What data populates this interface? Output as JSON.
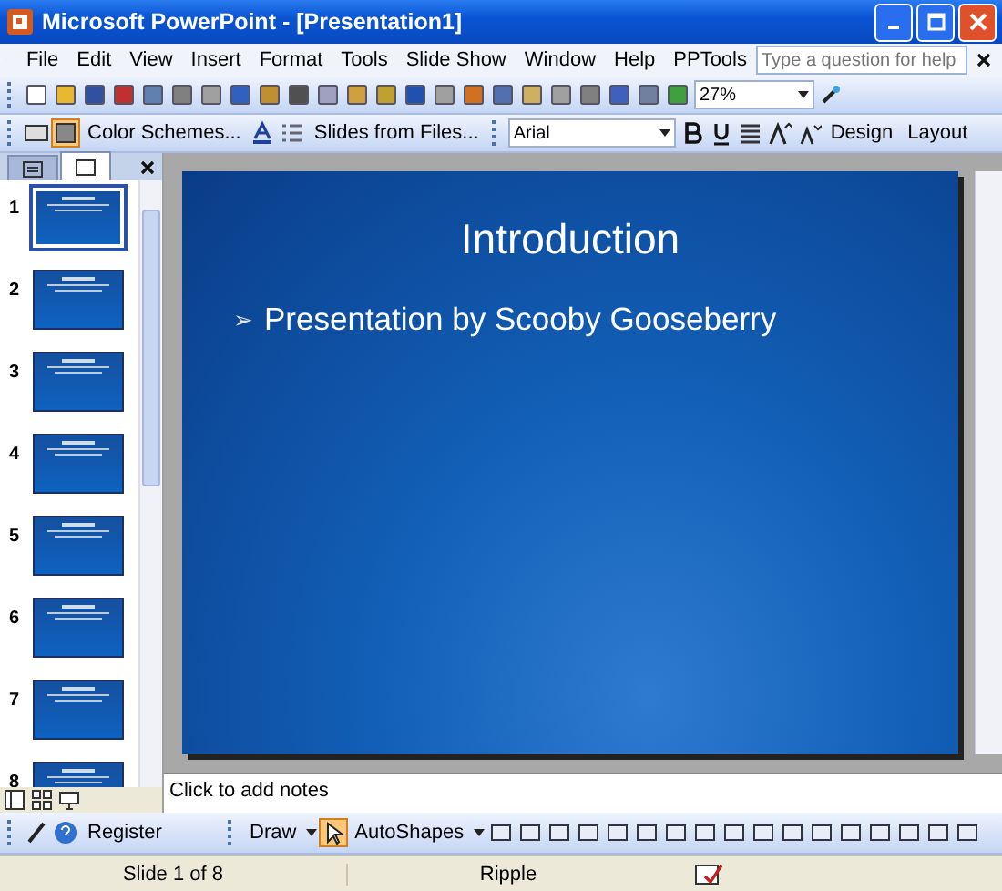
{
  "window": {
    "title": "Microsoft PowerPoint - [Presentation1]"
  },
  "menu": [
    "File",
    "Edit",
    "View",
    "Insert",
    "Format",
    "Tools",
    "Slide Show",
    "Window",
    "Help",
    "PPTools"
  ],
  "help_search": {
    "placeholder": "Type a question for help"
  },
  "standard_toolbar": {
    "zoom": "27%"
  },
  "formatting_toolbar": {
    "color_schemes": "Color Schemes...",
    "slides_from_files": "Slides from Files...",
    "font": "Arial",
    "design": "Design",
    "layout": "Layout"
  },
  "panel_tabs": [
    {
      "selected": false
    },
    {
      "selected": true
    }
  ],
  "thumbnails": [
    {
      "number": "1",
      "selected": true
    },
    {
      "number": "2",
      "selected": false
    },
    {
      "number": "3",
      "selected": false
    },
    {
      "number": "4",
      "selected": false
    },
    {
      "number": "5",
      "selected": false
    },
    {
      "number": "6",
      "selected": false
    },
    {
      "number": "7",
      "selected": false
    },
    {
      "number": "8",
      "selected": false
    }
  ],
  "slide": {
    "title": "Introduction",
    "bullet_marker": "➢",
    "bullets": [
      "Presentation by Scooby Gooseberry"
    ]
  },
  "notes": {
    "placeholder": "Click to add notes"
  },
  "drawing_toolbar": {
    "register": "Register",
    "draw": "Draw",
    "autoshapes": "AutoShapes"
  },
  "status_bar": {
    "slide": "Slide 1 of 8",
    "design": "Ripple"
  }
}
